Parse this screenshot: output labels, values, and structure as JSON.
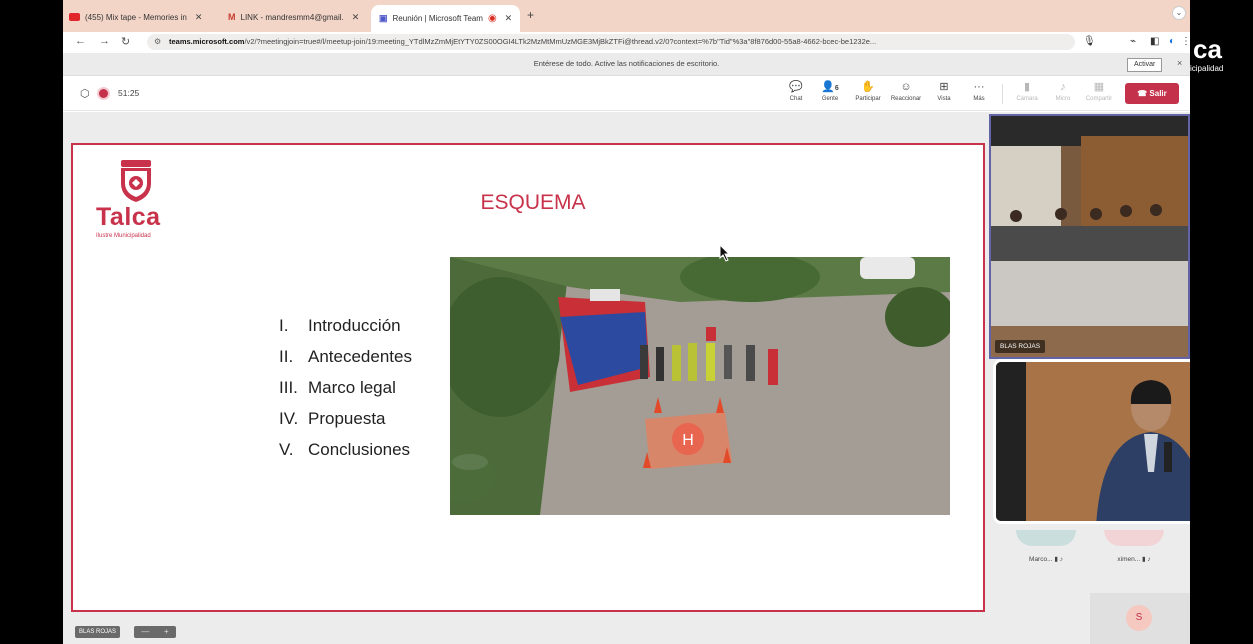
{
  "browser": {
    "tabs": [
      {
        "label": "(455) Mix tape - Memories in",
        "favicon_color": "#e0252b"
      },
      {
        "label": "LINK - mandresmm4@gmail.",
        "favicon_color": "#c63d2f"
      },
      {
        "label": "Reunión | Microsoft Team",
        "favicon_color": "#5059c9"
      }
    ],
    "new_tab": "+",
    "url_host": "teams.microsoft.com",
    "url_rest": "/v2/?meetingjoin=true#/l/meetup-join/19:meeting_YTdlMzZmMjEtYTY0ZS00OGI4LTk2MzMtMmUzMGE3MjBkZTFi@thread.v2/0?context=%7b\"Tid\"%3a\"8f876d00-55a8-4662-bcec-be1232e..."
  },
  "notification": {
    "message": "Entérese de todo. Active las notificaciones de escritorio.",
    "action": "Activar",
    "close": "×"
  },
  "meeting": {
    "timer": "51:25",
    "controls": [
      {
        "icon": "chat-icon",
        "glyph": "☺",
        "label": "Chat"
      },
      {
        "icon": "people-icon",
        "glyph": "ꔮ",
        "label": "Gente",
        "count": "6"
      },
      {
        "icon": "raise-hand-icon",
        "glyph": "✋",
        "label": "Participar"
      },
      {
        "icon": "react-icon",
        "glyph": "☺",
        "label": "Reaccionar"
      },
      {
        "icon": "view-icon",
        "glyph": "⊞",
        "label": "Vista"
      },
      {
        "icon": "more-icon",
        "glyph": "···",
        "label": "Más"
      }
    ],
    "media": [
      {
        "icon": "camera-off-icon",
        "glyph": "▮",
        "label": "Cámara"
      },
      {
        "icon": "mic-off-icon",
        "glyph": "♪",
        "label": "Micro"
      },
      {
        "icon": "share-icon",
        "glyph": "▦",
        "label": "Compartir"
      }
    ],
    "leave": "Salir",
    "accent": "#c4314b"
  },
  "slide": {
    "logo_name": "Talca",
    "logo_subtitle": "Ilustre Municipalidad",
    "title": "ESQUEMA",
    "brand_color": "#c8324b",
    "agenda": [
      {
        "num": "I.",
        "text": "Introducción"
      },
      {
        "num": "II.",
        "text": "Antecedentes"
      },
      {
        "num": "III.",
        "text": "Marco legal"
      },
      {
        "num": "IV.",
        "text": "Propuesta"
      },
      {
        "num": "V.",
        "text": "Conclusiones"
      }
    ]
  },
  "videos": {
    "room_name": "BLAS ROJAS",
    "participants": [
      {
        "name": "Marco...",
        "color": "#c9dedd"
      },
      {
        "name": "ximen...",
        "color": "#f2d4d6"
      }
    ],
    "self_initial": "S",
    "presenter_tag": "BLAS ROJAS",
    "zoom_minus": "—",
    "zoom_plus": "+"
  },
  "overlay": {
    "brand_big": "ca",
    "brand_small": "icipalidad"
  }
}
